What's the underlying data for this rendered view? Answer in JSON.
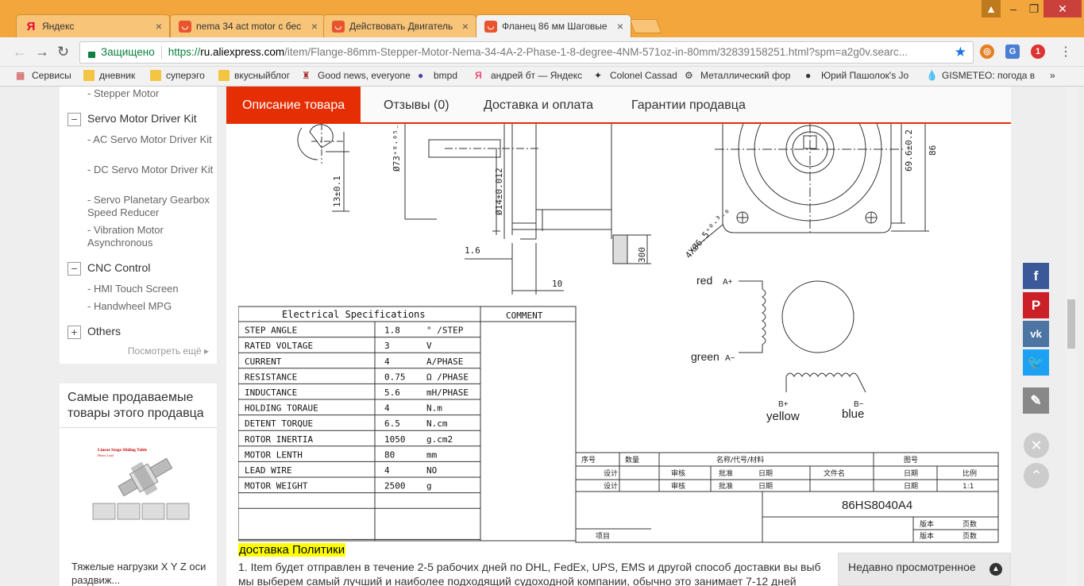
{
  "browser": {
    "tabs": [
      {
        "label": "Яндекс",
        "favicon": "yandex-icon"
      },
      {
        "label": "nema 34 act motor с бес",
        "favicon": "aliexpress-icon"
      },
      {
        "label": "Действовать Двигатель",
        "favicon": "aliexpress-icon"
      },
      {
        "label": "Фланец 86 мм Шаговые",
        "favicon": "aliexpress-icon"
      }
    ],
    "secure_label": "Защищено",
    "url_proto": "https://",
    "url_host": "ru.aliexpress.com",
    "url_rest": "/item/Flange-86mm-Stepper-Motor-Nema-34-4A-2-Phase-1-8-degree-4NM-571oz-in-80mm/32839158251.html?spm=a2g0v.searc...",
    "bookmarks": [
      "Сервисы",
      "дневник",
      "суперэго",
      "вкусныйблог",
      "Good news, everyone",
      "bmpd",
      "андрей бт — Яндекс",
      "Colonel Cassad",
      "Металлический фор",
      "Юрий Пашолок's Jo",
      "GISMETEO: погода в"
    ],
    "ext_badge": "1"
  },
  "sidebar": {
    "sub_top": "- Stepper Motor",
    "cat_servo": "Servo Motor Driver Kit",
    "servo_items": [
      "- AC Servo Motor Driver Kit",
      "- DC Servo Motor Driver Kit",
      "- Servo Planetary Gearbox Speed Reducer",
      "- Vibration Motor Asynchronous"
    ],
    "cat_cnc": "CNC Control",
    "cnc_items": [
      "- HMI Touch Screen",
      "- Handwheel MPG"
    ],
    "cat_others": "Others",
    "see_more": "Посмотреть ещё"
  },
  "bestsellers": {
    "title": "Самые продаваемые товары этого продавца",
    "image_caption": "Linear Stage Sliding Table",
    "image_sub": "Heavy Load",
    "item_caption": "Тяжелые нагрузки X Y Z оси раздвиж..."
  },
  "product_tabs": [
    "Описание товара",
    "Отзывы (0)",
    "Доставка и оплата",
    "Гарантии продавца"
  ],
  "drawing": {
    "dims": {
      "d73": "Ø73⁺⁰·⁰⁵₋₀.₀₃",
      "d14": "Ø14±0.012",
      "h13": "13±0.1",
      "l16": "1.6",
      "l10": "10",
      "l300": "300",
      "d696": "69.6±0.2",
      "d86": "86",
      "holes": "4XØ6.5⁺⁰·³₋₀"
    },
    "wiring": {
      "red": "red",
      "a_plus": "A+",
      "green": "green",
      "a_minus": "A−",
      "b_plus": "B+",
      "b_minus": "B−",
      "yellow": "yellow",
      "blue": "blue"
    },
    "spec_title": "Electrical Specifications",
    "comment_title": "COMMENT",
    "specs": [
      {
        "name": "STEP ANGLE",
        "value": "1.8",
        "unit": "° /STEP"
      },
      {
        "name": "RATED VOLTAGE",
        "value": "3",
        "unit": "V"
      },
      {
        "name": "CURRENT",
        "value": "4",
        "unit": "A/PHASE"
      },
      {
        "name": "RESISTANCE",
        "value": "0.75",
        "unit": "Ω /PHASE"
      },
      {
        "name": "INDUCTANCE",
        "value": "5.6",
        "unit": "mH/PHASE"
      },
      {
        "name": "HOLDING TORAUE",
        "value": "4",
        "unit": "N.m"
      },
      {
        "name": "DETENT TORQUE",
        "value": "6.5",
        "unit": "N.cm"
      },
      {
        "name": "ROTOR INERTIA",
        "value": "1050",
        "unit": "g.cm2"
      },
      {
        "name": "MOTOR LENTH",
        "value": "80",
        "unit": "mm"
      },
      {
        "name": "LEAD WIRE",
        "value": "4",
        "unit": "NO"
      },
      {
        "name": "MOTOR WEIGHT",
        "value": "2500",
        "unit": "g"
      }
    ],
    "title_block": {
      "seq": "序号",
      "qty": "数量",
      "name": "名称/代号/材料",
      "fig": "图号",
      "design": "设计",
      "review": "审核",
      "approve": "批准",
      "date": "日期",
      "filename": "文件名",
      "scale": "比例",
      "scale_val": "1:1",
      "model": "86HS8040A4",
      "project": "项目",
      "version": "版本",
      "page": "页数"
    }
  },
  "policy": {
    "title": "доставка Политики",
    "text": "1. Item будет отправлен в течение 2-5 рабочих дней по DHL, FedEx, UPS, EMS и другой способ доставки вы выб",
    "text2": "мы выберем самый лучший и наиболее подходящий судоходной компании, обычно это занимает 7-12 дней"
  },
  "recent": "Недавно просмотренное"
}
